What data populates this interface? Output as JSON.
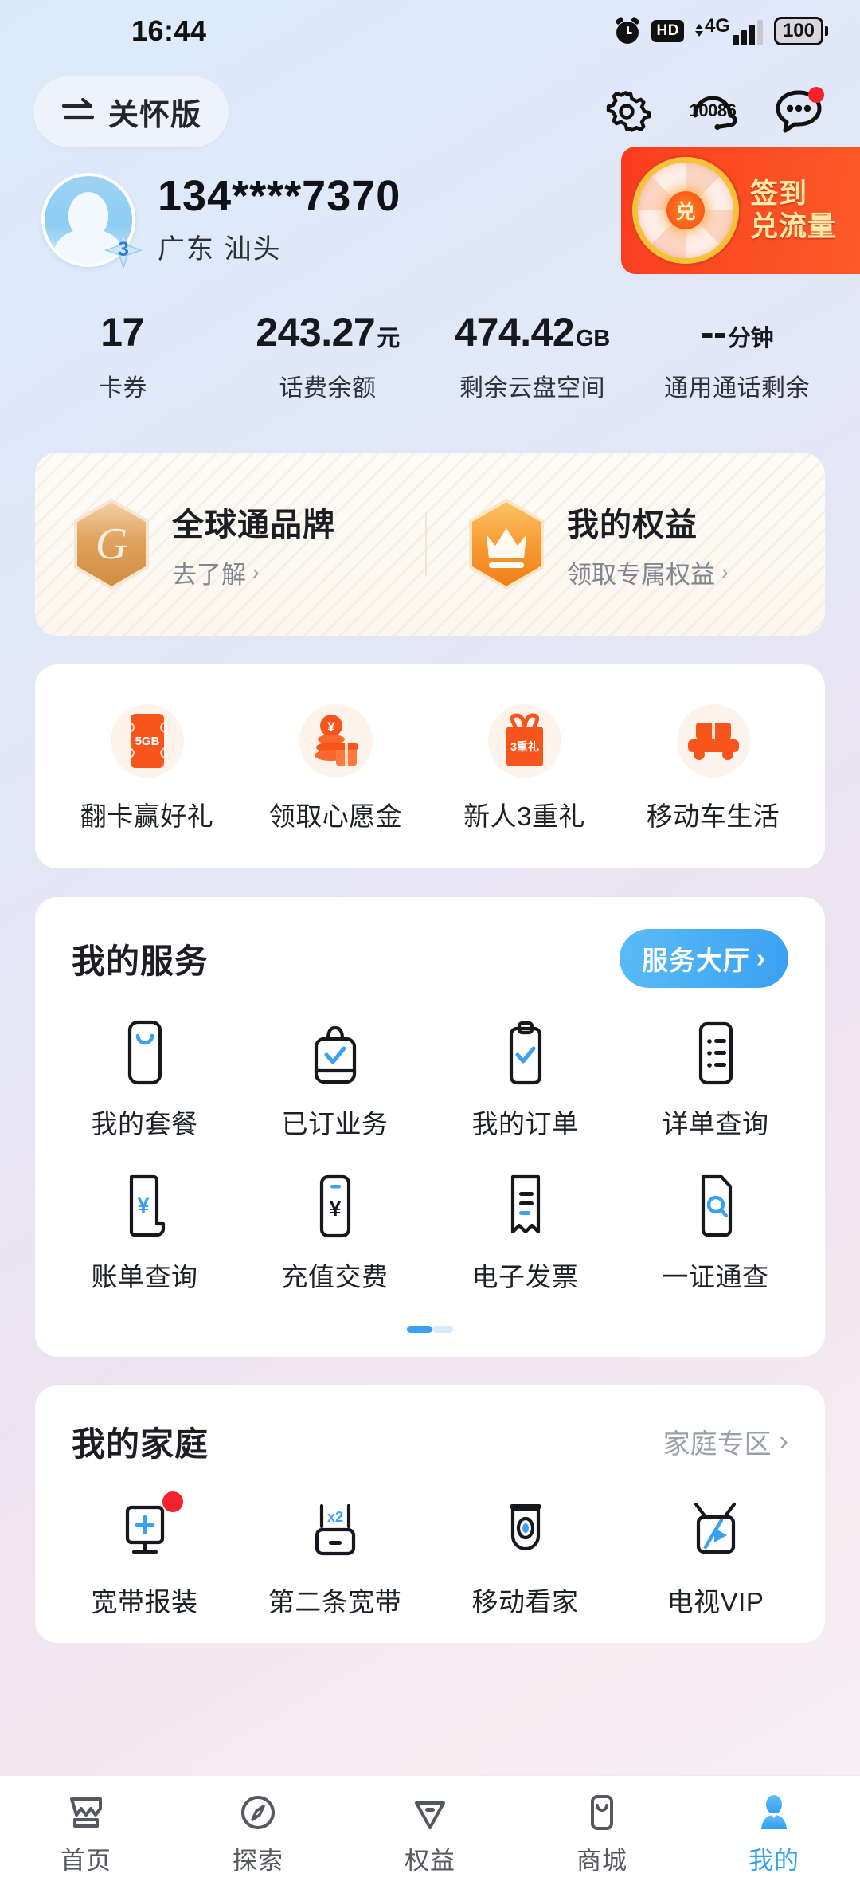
{
  "statusbar": {
    "time": "16:44",
    "hd": "HD",
    "network": "4G",
    "battery": "100",
    "icons": [
      "alarm-icon",
      "hd-icon",
      "signal-icon",
      "battery-icon"
    ]
  },
  "header": {
    "care_label": "关怀版",
    "swap_icon": "swap-arrows-icon",
    "gear_icon": "gear-icon",
    "hotline_icon": "headset-icon",
    "hotline_number": "10086",
    "chat_icon": "chat-bubble-icon",
    "chat_has_badge": true
  },
  "profile": {
    "phone": "134****7370",
    "region": "广东 汕头",
    "level_badge": "3",
    "avatar_icon": "user-avatar-icon"
  },
  "signin_banner": {
    "wheel_center": "兑",
    "line1": "签到",
    "line2": "兑流量",
    "wheel_icon": "prize-wheel-icon",
    "bg_color": "#fb4a22",
    "text_color": "#ffe9a8"
  },
  "stats": [
    {
      "value": "17",
      "unit": "",
      "label": "卡券"
    },
    {
      "value": "243.27",
      "unit": "元",
      "label": "话费余额"
    },
    {
      "value": "474.42",
      "unit": "GB",
      "label": "剩余云盘空间"
    },
    {
      "value": "--",
      "unit": "分钟",
      "label": "通用通话剩余"
    }
  ],
  "brand_card": [
    {
      "title": "全球通品牌",
      "sub": "去了解",
      "chevron": "›",
      "icon": "gotone-hex-badge-icon"
    },
    {
      "title": "我的权益",
      "sub": "领取专属权益",
      "chevron": "›",
      "icon": "crown-hex-badge-icon"
    }
  ],
  "promos": [
    {
      "label": "翻卡赢好礼",
      "icon": "data-card-5gb-icon",
      "badge": "5GB"
    },
    {
      "label": "领取心愿金",
      "icon": "coins-gift-icon",
      "badge": "¥"
    },
    {
      "label": "新人3重礼",
      "icon": "gift-box-icon",
      "badge": "3重礼"
    },
    {
      "label": "移动车生活",
      "icon": "car-icon",
      "badge": ""
    }
  ],
  "services": {
    "title": "我的服务",
    "hall_button": "服务大厅",
    "hall_chevron": "›",
    "items": [
      {
        "label": "我的套餐",
        "icon": "phone-package-icon"
      },
      {
        "label": "已订业务",
        "icon": "bag-check-icon"
      },
      {
        "label": "我的订单",
        "icon": "clipboard-check-icon"
      },
      {
        "label": "详单查询",
        "icon": "list-detail-icon"
      },
      {
        "label": "账单查询",
        "icon": "bill-yuan-icon"
      },
      {
        "label": "充值交费",
        "icon": "recharge-yuan-icon"
      },
      {
        "label": "电子发票",
        "icon": "invoice-icon"
      },
      {
        "label": "一证通查",
        "icon": "id-search-icon"
      }
    ],
    "page_dots": 2,
    "active_dot": 0
  },
  "family": {
    "title": "我的家庭",
    "link": "家庭专区",
    "link_chevron": "›",
    "items": [
      {
        "label": "宽带报装",
        "icon": "broadband-install-icon",
        "badge": true
      },
      {
        "label": "第二条宽带",
        "icon": "router-x2-icon",
        "badge": false
      },
      {
        "label": "移动看家",
        "icon": "security-camera-icon",
        "badge": false
      },
      {
        "label": "电视VIP",
        "icon": "tv-play-icon",
        "badge": false
      }
    ]
  },
  "tabbar": {
    "active_color": "#33a2f4",
    "items": [
      {
        "label": "首页",
        "icon": "home-icon",
        "active": false
      },
      {
        "label": "探索",
        "icon": "compass-icon",
        "active": false
      },
      {
        "label": "权益",
        "icon": "benefits-tag-icon",
        "active": false
      },
      {
        "label": "商城",
        "icon": "mall-phone-icon",
        "active": false
      },
      {
        "label": "我的",
        "icon": "person-icon",
        "active": true
      }
    ]
  }
}
